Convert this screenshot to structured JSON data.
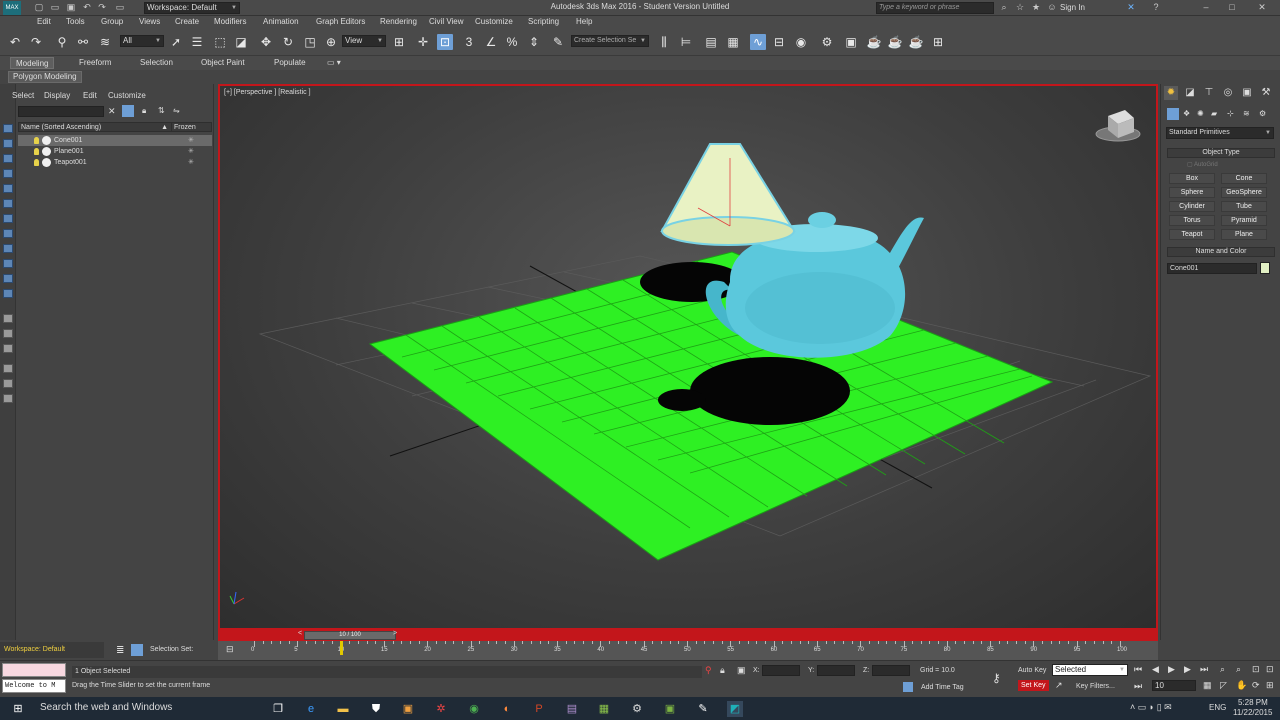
{
  "window": {
    "title": "Autodesk 3ds Max 2016 - Student Version   Untitled",
    "workspace_dd": "Workspace: Default",
    "search_placeholder": "Type a keyword or phrase",
    "signin": "Sign In"
  },
  "menu": [
    "Edit",
    "Tools",
    "Group",
    "Views",
    "Create",
    "Modifiers",
    "Animation",
    "Graph Editors",
    "Rendering",
    "Civil View",
    "Customize",
    "Scripting",
    "Help"
  ],
  "toolbar": {
    "selection_filter": "All",
    "ref_coord": "View",
    "named_selection": "Create Selection Se"
  },
  "ribbon": {
    "tabs": [
      "Modeling",
      "Freeform",
      "Selection",
      "Object Paint",
      "Populate"
    ],
    "sub_label": "Polygon Modeling"
  },
  "explorer": {
    "menus": [
      "Select",
      "Display",
      "Edit",
      "Customize"
    ],
    "col_name": "Name (Sorted Ascending)",
    "col_frozen": "Frozen",
    "rows": [
      {
        "name": "Cone001",
        "selected": true
      },
      {
        "name": "Plane001",
        "selected": false
      },
      {
        "name": "Teapot001",
        "selected": false
      }
    ]
  },
  "viewport": {
    "label": "[+] [Perspective ] [Realistic ]",
    "plane_color": "#2ef023",
    "teapot_color": "#5bc8dc",
    "cone_color": "#e9f2c4"
  },
  "cmd": {
    "category": "Standard Primitives",
    "rollout_object_type": "Object Type",
    "autogrid": "AutoGrid",
    "buttons": [
      "Box",
      "Cone",
      "Sphere",
      "GeoSphere",
      "Cylinder",
      "Tube",
      "Torus",
      "Pyramid",
      "Teapot",
      "Plane"
    ],
    "rollout_name_color": "Name and Color",
    "name_value": "Cone001",
    "object_color": "#e2f0c4"
  },
  "time": {
    "slider_label": "10 / 100",
    "current_frame": 10,
    "total_frames": 100,
    "ticks": [
      "0",
      "5",
      "10",
      "15",
      "20",
      "25",
      "30",
      "35",
      "40",
      "45",
      "50",
      "55",
      "60",
      "65",
      "70",
      "75",
      "80",
      "85",
      "90",
      "95",
      "100"
    ]
  },
  "bottom": {
    "workspace": "Workspace: Default",
    "selection_sets": "Selection Set:",
    "maxscript": "Welcome to M",
    "status": "1 Object Selected",
    "prompt": "Drag the Time Slider to set the current frame",
    "x_label": "X:",
    "y_label": "Y:",
    "z_label": "Z:",
    "grid": "Grid = 10.0",
    "add_time_tag": "Add Time Tag",
    "auto_key": "Auto Key",
    "selected_dd": "Selected",
    "set_key": "Set Key",
    "key_filters": "Key Filters...",
    "frame_field": "10"
  },
  "taskbar": {
    "search": "Search the web and Windows",
    "time": "5:28 PM",
    "date": "11/22/2015",
    "lang": "ENG"
  }
}
